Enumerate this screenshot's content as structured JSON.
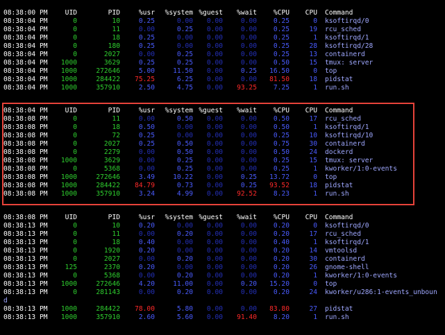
{
  "header": {
    "time": "",
    "uid": "UID",
    "pid": "PID",
    "usr": "%usr",
    "system": "%system",
    "guest": "%guest",
    "wait": "%wait",
    "cpu": "%CPU",
    "cpun": "CPU",
    "command": "Command"
  },
  "blocks": [
    {
      "header_time": "08:38:00 PM",
      "rows": [
        {
          "time": "08:38:04 PM",
          "uid": "0",
          "pid": "10",
          "usr": "0.25",
          "system": "0.00",
          "guest": "0.00",
          "wait": "0.00",
          "cpu": "0.25",
          "cpun": "0",
          "command": "ksoftirqd/0"
        },
        {
          "time": "08:38:04 PM",
          "uid": "0",
          "pid": "11",
          "usr": "0.00",
          "system": "0.25",
          "guest": "0.00",
          "wait": "0.00",
          "cpu": "0.25",
          "cpun": "19",
          "command": "rcu_sched"
        },
        {
          "time": "08:38:04 PM",
          "uid": "0",
          "pid": "18",
          "usr": "0.25",
          "system": "0.00",
          "guest": "0.00",
          "wait": "0.00",
          "cpu": "0.25",
          "cpun": "1",
          "command": "ksoftirqd/1"
        },
        {
          "time": "08:38:04 PM",
          "uid": "0",
          "pid": "180",
          "usr": "0.25",
          "system": "0.00",
          "guest": "0.00",
          "wait": "0.00",
          "cpu": "0.25",
          "cpun": "28",
          "command": "ksoftirqd/28"
        },
        {
          "time": "08:38:04 PM",
          "uid": "0",
          "pid": "2027",
          "usr": "0.00",
          "system": "0.25",
          "guest": "0.00",
          "wait": "0.00",
          "cpu": "0.25",
          "cpun": "13",
          "command": "containerd"
        },
        {
          "time": "08:38:04 PM",
          "uid": "1000",
          "pid": "3629",
          "usr": "0.25",
          "system": "0.25",
          "guest": "0.00",
          "wait": "0.00",
          "cpu": "0.50",
          "cpun": "15",
          "command": "tmux: server"
        },
        {
          "time": "08:38:04 PM",
          "uid": "1000",
          "pid": "272646",
          "usr": "5.00",
          "system": "11.50",
          "guest": "0.00",
          "wait": "0.25",
          "cpu": "16.50",
          "cpun": "0",
          "command": "top"
        },
        {
          "time": "08:38:04 PM",
          "uid": "1000",
          "pid": "284422",
          "usr": "75.25",
          "system": "6.25",
          "guest": "0.00",
          "wait": "0.00",
          "cpu": "81.50",
          "cpun": "18",
          "command": "pidstat"
        },
        {
          "time": "08:38:04 PM",
          "uid": "1000",
          "pid": "357910",
          "usr": "2.50",
          "system": "4.75",
          "guest": "0.00",
          "wait": "93.25",
          "cpu": "7.25",
          "cpun": "1",
          "command": "run.sh"
        }
      ]
    },
    {
      "header_time": "08:38:04 PM",
      "rows": [
        {
          "time": "08:38:08 PM",
          "uid": "0",
          "pid": "11",
          "usr": "0.00",
          "system": "0.50",
          "guest": "0.00",
          "wait": "0.00",
          "cpu": "0.50",
          "cpun": "17",
          "command": "rcu_sched"
        },
        {
          "time": "08:38:08 PM",
          "uid": "0",
          "pid": "18",
          "usr": "0.50",
          "system": "0.00",
          "guest": "0.00",
          "wait": "0.00",
          "cpu": "0.50",
          "cpun": "1",
          "command": "ksoftirqd/1"
        },
        {
          "time": "08:38:08 PM",
          "uid": "0",
          "pid": "72",
          "usr": "0.25",
          "system": "0.00",
          "guest": "0.00",
          "wait": "0.00",
          "cpu": "0.25",
          "cpun": "10",
          "command": "ksoftirqd/10"
        },
        {
          "time": "08:38:08 PM",
          "uid": "0",
          "pid": "2027",
          "usr": "0.25",
          "system": "0.50",
          "guest": "0.00",
          "wait": "0.00",
          "cpu": "0.75",
          "cpun": "30",
          "command": "containerd"
        },
        {
          "time": "08:38:08 PM",
          "uid": "0",
          "pid": "2279",
          "usr": "0.00",
          "system": "0.50",
          "guest": "0.00",
          "wait": "0.00",
          "cpu": "0.50",
          "cpun": "24",
          "command": "dockerd"
        },
        {
          "time": "08:38:08 PM",
          "uid": "1000",
          "pid": "3629",
          "usr": "0.00",
          "system": "0.25",
          "guest": "0.00",
          "wait": "0.00",
          "cpu": "0.25",
          "cpun": "15",
          "command": "tmux: server"
        },
        {
          "time": "08:38:08 PM",
          "uid": "0",
          "pid": "5368",
          "usr": "0.00",
          "system": "0.25",
          "guest": "0.00",
          "wait": "0.00",
          "cpu": "0.25",
          "cpun": "1",
          "command": "kworker/1:0-events"
        },
        {
          "time": "08:38:08 PM",
          "uid": "1000",
          "pid": "272646",
          "usr": "3.49",
          "system": "10.22",
          "guest": "0.00",
          "wait": "0.25",
          "cpu": "13.72",
          "cpun": "0",
          "command": "top"
        },
        {
          "time": "08:38:08 PM",
          "uid": "1000",
          "pid": "284422",
          "usr": "84.79",
          "system": "0.73",
          "guest": "0.00",
          "wait": "0.25",
          "cpu": "93.52",
          "cpun": "18",
          "command": "pidstat"
        },
        {
          "time": "08:38:08 PM",
          "uid": "1000",
          "pid": "357910",
          "usr": "3.24",
          "system": "4.99",
          "guest": "0.00",
          "wait": "92.52",
          "cpu": "8.23",
          "cpun": "1",
          "command": "run.sh"
        }
      ]
    },
    {
      "header_time": "08:38:08 PM",
      "rows": [
        {
          "time": "08:38:13 PM",
          "uid": "0",
          "pid": "10",
          "usr": "0.20",
          "system": "0.00",
          "guest": "0.00",
          "wait": "0.00",
          "cpu": "0.20",
          "cpun": "0",
          "command": "ksoftirqd/0"
        },
        {
          "time": "08:38:13 PM",
          "uid": "0",
          "pid": "11",
          "usr": "0.00",
          "system": "0.20",
          "guest": "0.00",
          "wait": "0.00",
          "cpu": "0.20",
          "cpun": "17",
          "command": "rcu_sched"
        },
        {
          "time": "08:38:13 PM",
          "uid": "0",
          "pid": "18",
          "usr": "0.40",
          "system": "0.00",
          "guest": "0.00",
          "wait": "0.00",
          "cpu": "0.40",
          "cpun": "1",
          "command": "ksoftirqd/1"
        },
        {
          "time": "08:38:13 PM",
          "uid": "0",
          "pid": "1920",
          "usr": "0.20",
          "system": "0.00",
          "guest": "0.00",
          "wait": "0.00",
          "cpu": "0.20",
          "cpun": "14",
          "command": "vmtoolsd"
        },
        {
          "time": "08:38:13 PM",
          "uid": "0",
          "pid": "2027",
          "usr": "0.00",
          "system": "0.20",
          "guest": "0.00",
          "wait": "0.00",
          "cpu": "0.20",
          "cpun": "30",
          "command": "containerd"
        },
        {
          "time": "08:38:13 PM",
          "uid": "125",
          "pid": "2370",
          "usr": "0.20",
          "system": "0.00",
          "guest": "0.00",
          "wait": "0.00",
          "cpu": "0.20",
          "cpun": "26",
          "command": "gnome-shell"
        },
        {
          "time": "08:38:13 PM",
          "uid": "0",
          "pid": "5368",
          "usr": "0.00",
          "system": "0.20",
          "guest": "0.00",
          "wait": "0.00",
          "cpu": "0.20",
          "cpun": "1",
          "command": "kworker/1:0-events"
        },
        {
          "time": "08:38:13 PM",
          "uid": "1000",
          "pid": "272646",
          "usr": "4.20",
          "system": "11.00",
          "guest": "0.00",
          "wait": "0.20",
          "cpu": "15.20",
          "cpun": "0",
          "command": "top"
        },
        {
          "time": "08:38:13 PM",
          "uid": "0",
          "pid": "281143",
          "usr": "0.00",
          "system": "0.20",
          "guest": "0.00",
          "wait": "0.00",
          "cpu": "0.20",
          "cpun": "24",
          "command": "kworker/u286:1-events_unboun"
        },
        {
          "wrap": "d"
        },
        {
          "time": "08:38:13 PM",
          "uid": "1000",
          "pid": "284422",
          "usr": "78.00",
          "system": "5.80",
          "guest": "0.00",
          "wait": "0.00",
          "cpu": "83.80",
          "cpun": "27",
          "command": "pidstat"
        },
        {
          "time": "08:38:13 PM",
          "uid": "1000",
          "pid": "357910",
          "usr": "2.60",
          "system": "5.60",
          "guest": "0.00",
          "wait": "91.40",
          "cpu": "8.20",
          "cpun": "1",
          "command": "run.sh"
        }
      ]
    }
  ],
  "colors": {
    "highlight_border": "#e8433a",
    "value_blue": "#4a5cff",
    "value_dim": "#2430b8",
    "value_red": "#ff2a2a",
    "uid_green": "#2fd02f",
    "command": "#9fa8ff"
  }
}
